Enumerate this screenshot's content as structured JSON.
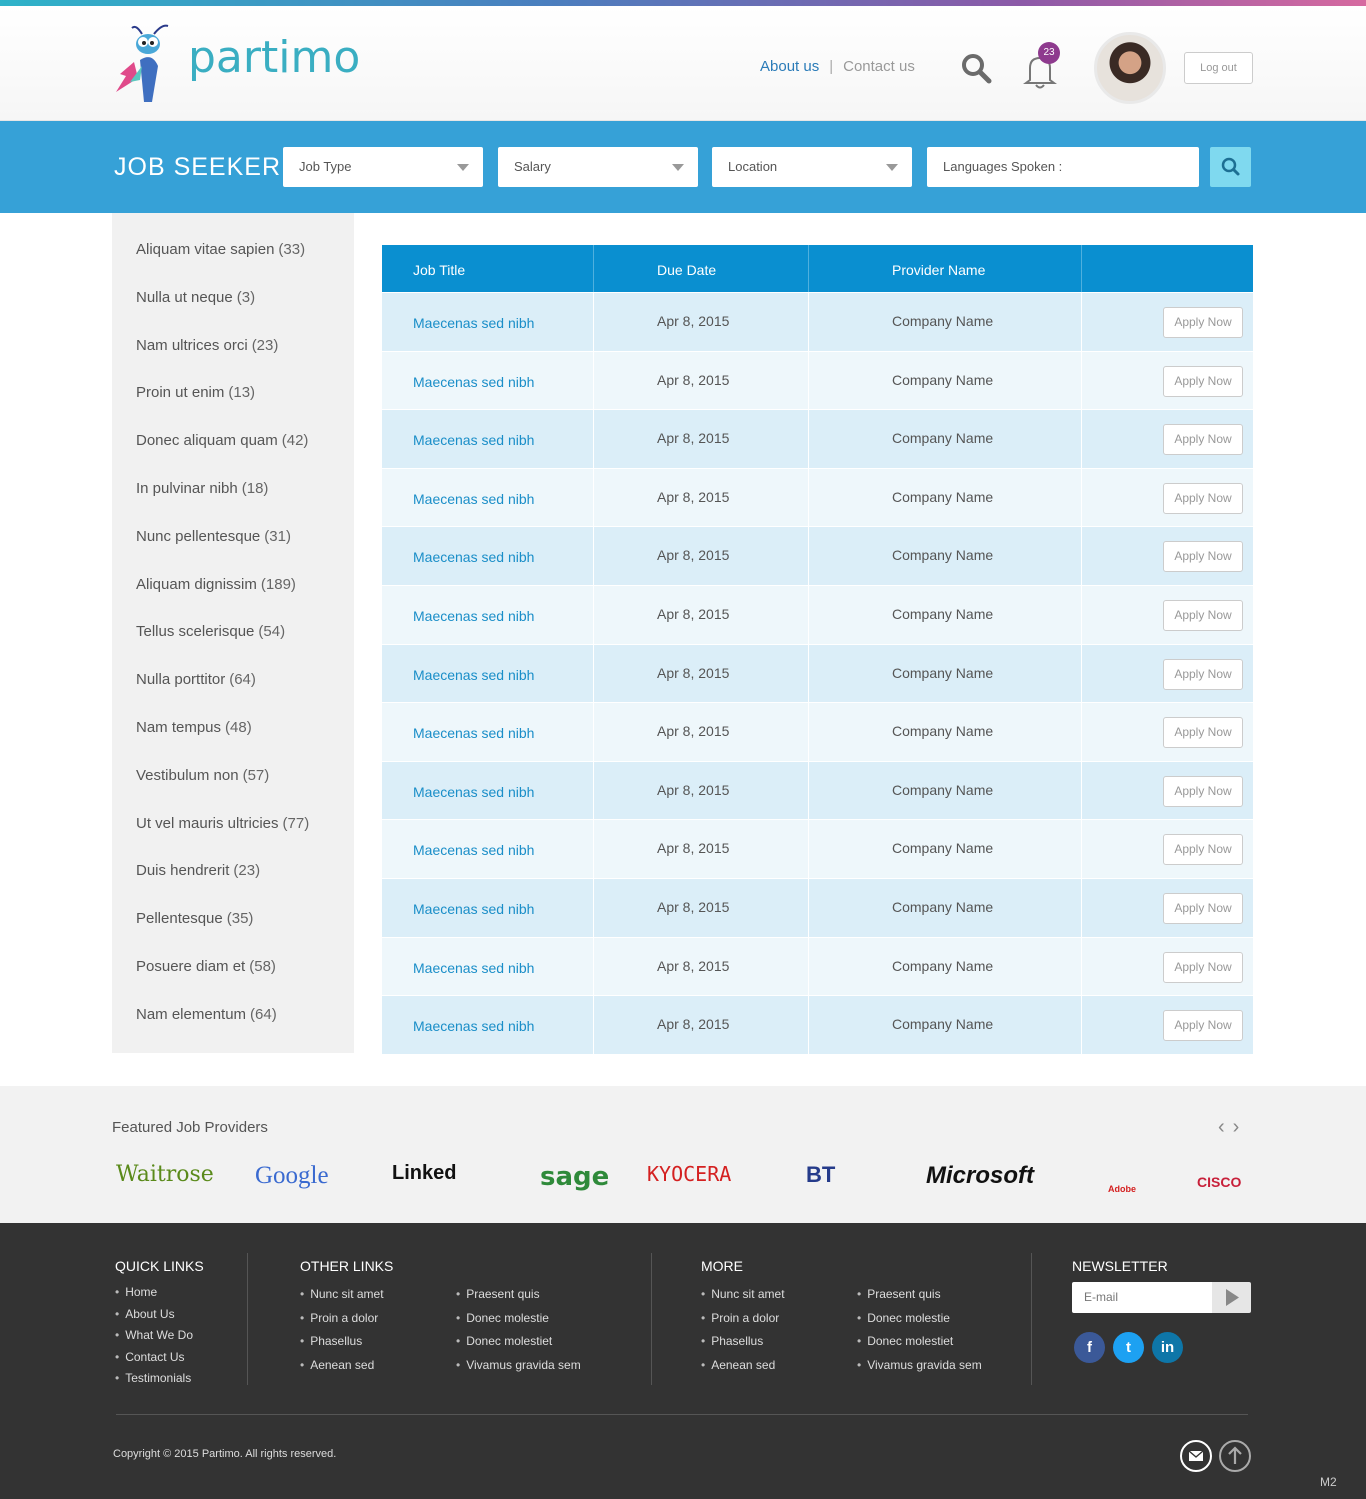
{
  "header": {
    "logo_text": "partimo",
    "nav_about": "About us",
    "nav_separator": "|",
    "nav_contact": "Contact us",
    "notification_count": "23",
    "logout_label": "Log out"
  },
  "search": {
    "title": "JOB SEEKER",
    "job_type": "Job Type",
    "salary": "Salary",
    "location": "Location",
    "languages": "Languages Spoken :"
  },
  "sidebar": {
    "items": [
      {
        "label": "Aliquam vitae sapien",
        "count": "(33)"
      },
      {
        "label": "Nulla ut neque",
        "count": "(3)"
      },
      {
        "label": "Nam ultrices orci",
        "count": "(23)"
      },
      {
        "label": "Proin ut enim",
        "count": "(13)"
      },
      {
        "label": "Donec aliquam quam",
        "count": "(42)"
      },
      {
        "label": "In pulvinar nibh",
        "count": "(18)"
      },
      {
        "label": "Nunc pellentesque",
        "count": "(31)"
      },
      {
        "label": "Aliquam dignissim",
        "count": "(189)"
      },
      {
        "label": "Tellus scelerisque",
        "count": "(54)"
      },
      {
        "label": "Nulla porttitor",
        "count": "(64)"
      },
      {
        "label": "Nam tempus",
        "count": "(48)"
      },
      {
        "label": "Vestibulum non",
        "count": "(57)"
      },
      {
        "label": "Ut vel mauris ultricies",
        "count": "(77)"
      },
      {
        "label": "Duis hendrerit",
        "count": "(23)"
      },
      {
        "label": "Pellentesque",
        "count": "(35)"
      },
      {
        "label": "Posuere diam et",
        "count": "(58)"
      },
      {
        "label": "Nam elementum",
        "count": "(64)"
      }
    ]
  },
  "table": {
    "headers": [
      "Job Title",
      "Due Date",
      "Provider Name",
      ""
    ],
    "rows": [
      {
        "title": "Maecenas sed nibh",
        "date": "Apr 8, 2015",
        "provider": "Company Name",
        "action": "Apply Now"
      },
      {
        "title": "Maecenas sed nibh",
        "date": "Apr 8, 2015",
        "provider": "Company Name",
        "action": "Apply Now"
      },
      {
        "title": "Maecenas sed nibh",
        "date": "Apr 8, 2015",
        "provider": "Company Name",
        "action": "Apply Now"
      },
      {
        "title": "Maecenas sed nibh",
        "date": "Apr 8, 2015",
        "provider": "Company Name",
        "action": "Apply Now"
      },
      {
        "title": "Maecenas sed nibh",
        "date": "Apr 8, 2015",
        "provider": "Company Name",
        "action": "Apply Now"
      },
      {
        "title": "Maecenas sed nibh",
        "date": "Apr 8, 2015",
        "provider": "Company Name",
        "action": "Apply Now"
      },
      {
        "title": "Maecenas sed nibh",
        "date": "Apr 8, 2015",
        "provider": "Company Name",
        "action": "Apply Now"
      },
      {
        "title": "Maecenas sed nibh",
        "date": "Apr 8, 2015",
        "provider": "Company Name",
        "action": "Apply Now"
      },
      {
        "title": "Maecenas sed nibh",
        "date": "Apr 8, 2015",
        "provider": "Company Name",
        "action": "Apply Now"
      },
      {
        "title": "Maecenas sed nibh",
        "date": "Apr 8, 2015",
        "provider": "Company Name",
        "action": "Apply Now"
      },
      {
        "title": "Maecenas sed nibh",
        "date": "Apr 8, 2015",
        "provider": "Company Name",
        "action": "Apply Now"
      },
      {
        "title": "Maecenas sed nibh",
        "date": "Apr 8, 2015",
        "provider": "Company Name",
        "action": "Apply Now"
      },
      {
        "title": "Maecenas sed nibh",
        "date": "Apr 8, 2015",
        "provider": "Company Name",
        "action": "Apply Now"
      }
    ]
  },
  "featured": {
    "title": "Featured Job Providers",
    "brands": [
      {
        "name": "Waitrose",
        "color": "#5a8a1a"
      },
      {
        "name": "Google",
        "color": "#3a6ad0"
      },
      {
        "name": "Linked",
        "color": "#111111"
      },
      {
        "name": "sage",
        "color": "#2f8a3a"
      },
      {
        "name": "KYOCERA",
        "color": "#d42020"
      },
      {
        "name": "BT",
        "color": "#253b8a"
      },
      {
        "name": "Microsoft",
        "color": "#111111"
      },
      {
        "name": "Adobe",
        "color": "#d42020"
      },
      {
        "name": "CISCO",
        "color": "#c8203a"
      }
    ]
  },
  "footer": {
    "quick_title": "QUICK LINKS",
    "quick": [
      "Home",
      "About Us",
      "What We Do",
      "Contact Us",
      "Testimonials"
    ],
    "other_title": "OTHER LINKS",
    "other_col1": [
      "Nunc sit amet",
      "Proin a dolor",
      "Phasellus",
      "Aenean sed"
    ],
    "other_col2": [
      "Praesent quis",
      "Donec molestie",
      "Donec molestiet",
      "Vivamus gravida sem"
    ],
    "more_title": "MORE",
    "more_col1": [
      "Nunc sit amet",
      "Proin a dolor",
      "Phasellus",
      "Aenean sed"
    ],
    "more_col2": [
      "Praesent quis",
      "Donec molestie",
      "Donec molestiet",
      "Vivamus gravida sem"
    ],
    "newsletter_title": "NEWSLETTER",
    "email_placeholder": "E-mail",
    "copyright": "Copyright  © 2015  Partimo.   All rights reserved.",
    "corner_tag": "M2",
    "social": [
      {
        "icon": "facebook-icon",
        "glyph": "f",
        "color": "#3b5998"
      },
      {
        "icon": "twitter-icon",
        "glyph": "t",
        "color": "#1da1f2"
      },
      {
        "icon": "linkedin-icon",
        "glyph": "in",
        "color": "#0e76a8"
      }
    ]
  },
  "colors": {
    "accent": "#36a1d7",
    "table_header": "#0a8fd0",
    "link": "#1a8ec8",
    "footer_bg": "#333333"
  }
}
